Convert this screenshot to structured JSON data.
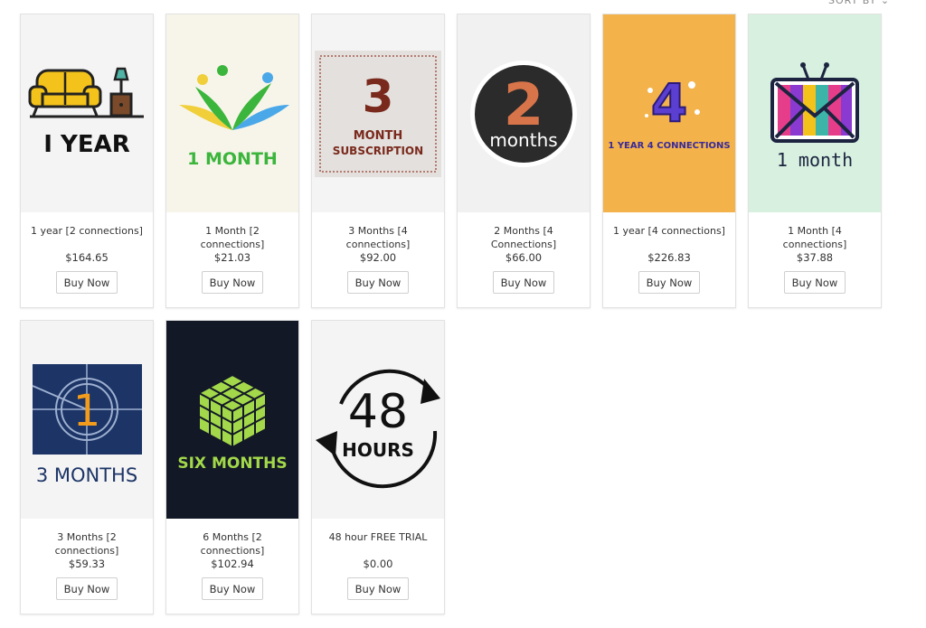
{
  "header": {
    "sort_label": "SORT BY ⌄"
  },
  "products": [
    {
      "title": "1 year [2 connections]",
      "price": "$164.65",
      "button": "Buy Now",
      "art_text": [
        "I YEAR"
      ],
      "bg": "#f4f4f4"
    },
    {
      "title": "1 Month [2 connections]",
      "price": "$21.03",
      "button": "Buy Now",
      "art_text": [
        "1 MONTH"
      ],
      "bg": "#f7f5ea"
    },
    {
      "title": "3 Months [4 connections]",
      "price": "$92.00",
      "button": "Buy Now",
      "art_text": [
        "3",
        "MONTH",
        "SUBSCRIPTION"
      ],
      "bg": "#f4f4f4"
    },
    {
      "title": "2 Months [4 Connections]",
      "price": "$66.00",
      "button": "Buy Now",
      "art_text": [
        "2",
        "months"
      ],
      "bg": "#f1f1f1"
    },
    {
      "title": "1 year [4 connections]",
      "price": "$226.83",
      "button": "Buy Now",
      "art_text": [
        "4",
        "1 YEAR 4 CONNECTIONS"
      ],
      "bg": "#f3b24a"
    },
    {
      "title": "1 Month [4 connections]",
      "price": "$37.88",
      "button": "Buy Now",
      "art_text": [
        "1 month"
      ],
      "bg": "#d7f0df"
    },
    {
      "title": "3 Months [2 connections]",
      "price": "$59.33",
      "button": "Buy Now",
      "art_text": [
        "1",
        "3 MONTHS"
      ],
      "bg": "#f4f4f4"
    },
    {
      "title": "6 Months [2 connections]",
      "price": "$102.94",
      "button": "Buy Now",
      "art_text": [
        "SIX MONTHS"
      ],
      "bg": "#121826"
    },
    {
      "title": "48 hour FREE TRIAL",
      "price": "$0.00",
      "button": "Buy Now",
      "art_text": [
        "48",
        "HOURS"
      ],
      "bg": "#f4f4f4"
    }
  ],
  "colors": {
    "accent_green": "#3cb53c",
    "cube_green": "#a3d84a",
    "navy": "#1c3466"
  }
}
